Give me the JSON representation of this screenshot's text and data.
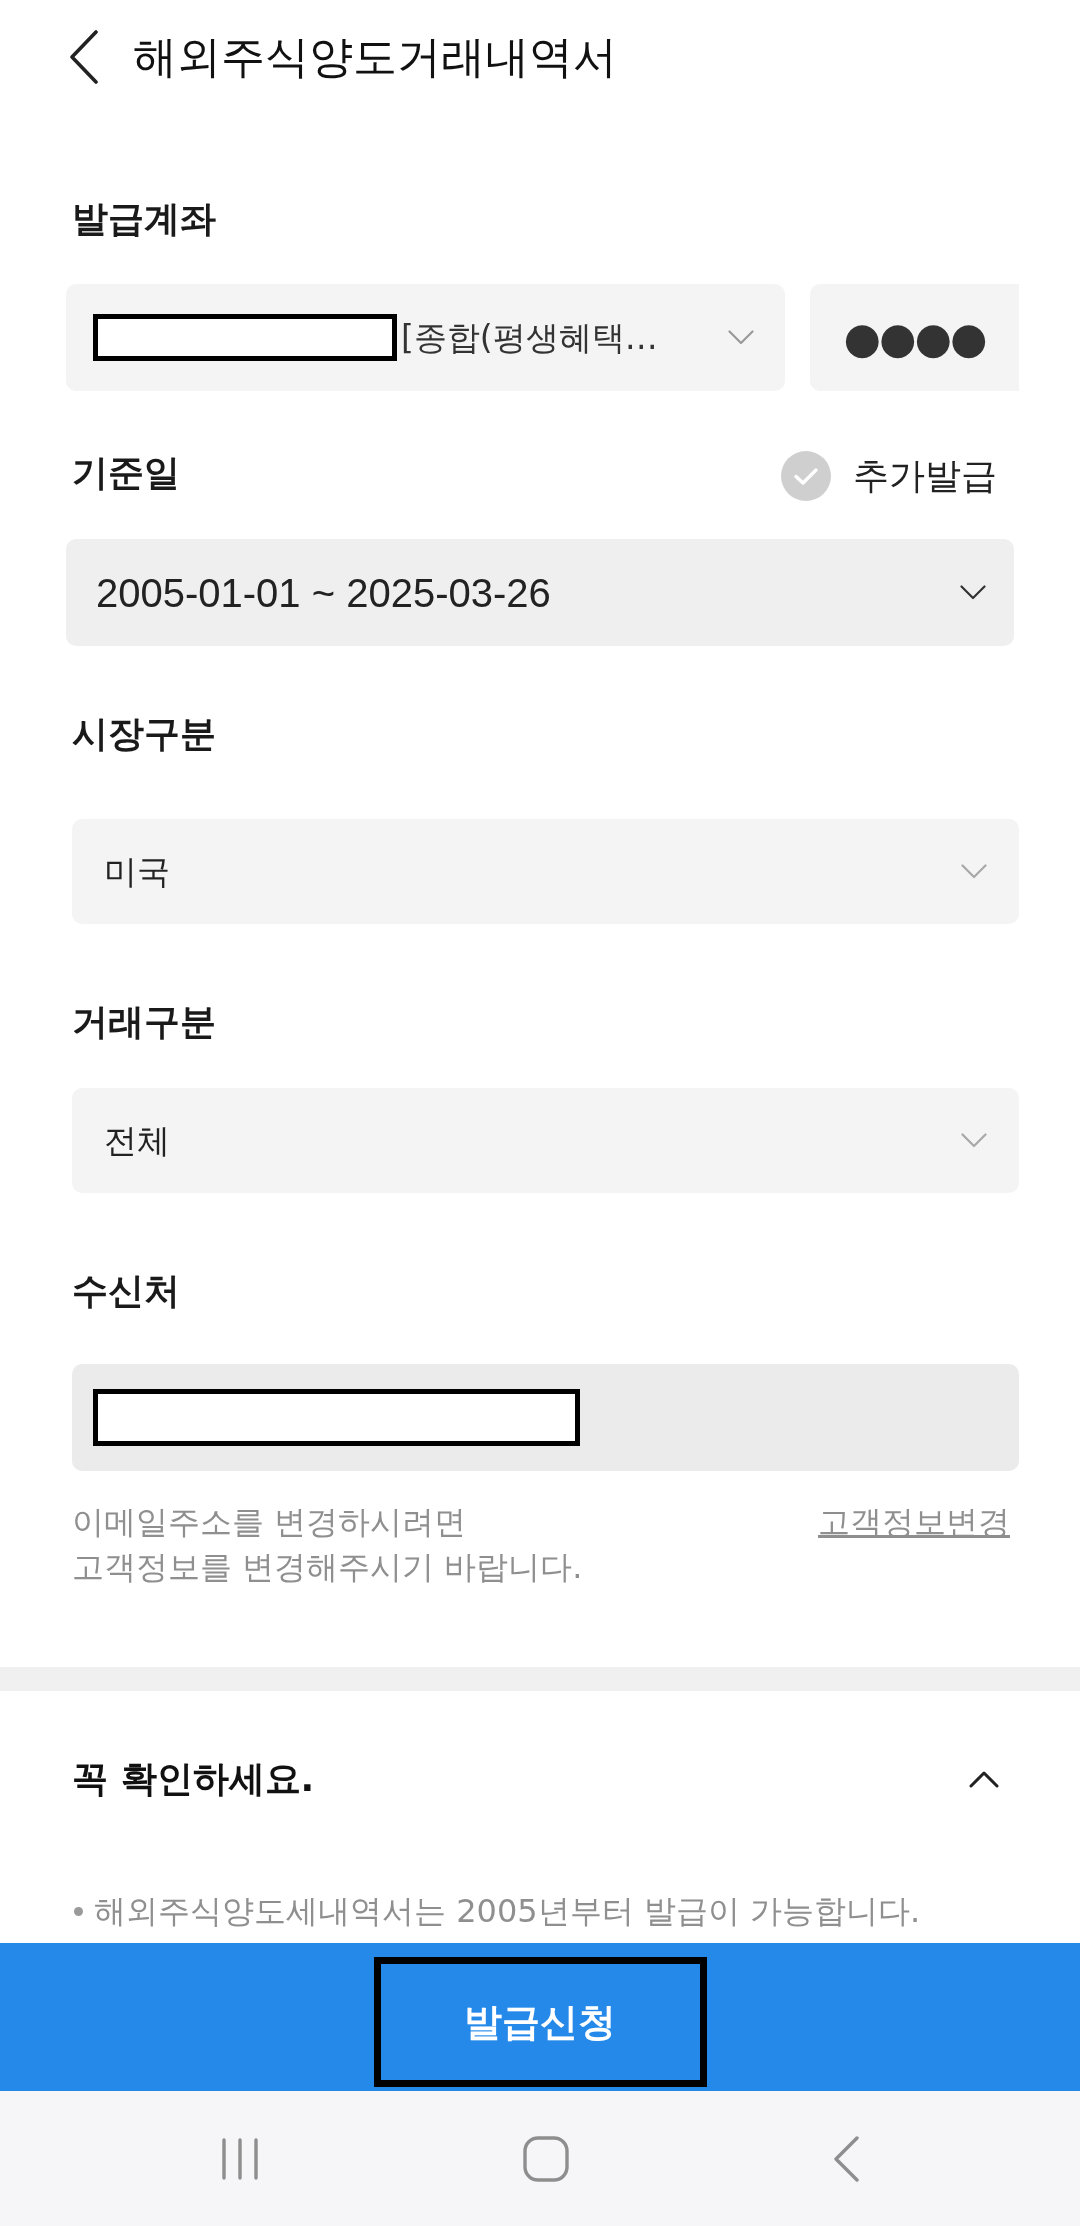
{
  "header": {
    "title": "해외주식양도거래내역서"
  },
  "account_section": {
    "label": "발급계좌",
    "account": {
      "redacted": true,
      "name": "[종합(평생혜택…"
    },
    "password": {
      "value": "●●●●"
    }
  },
  "date_section": {
    "label": "기준일",
    "additional_issue": {
      "label": "추가발급",
      "checked": false
    },
    "period": {
      "value": "2005-01-01 ~ 2025-03-26"
    }
  },
  "market_section": {
    "label": "시장구분",
    "select": {
      "value": "미국"
    }
  },
  "trade_section": {
    "label": "거래구분",
    "select": {
      "value": "전체"
    }
  },
  "recipient_section": {
    "label": "수신처",
    "email": {
      "redacted": true
    },
    "help": "이메일주소를 변경하시려면\n고객정보를 변경해주시기 바랍니다.",
    "link": "고객정보변경"
  },
  "notice": {
    "title": "꼭 확인하세요.",
    "expanded": true,
    "items": [
      "해외주식양도세내역서는 2005년부터 발급이 가능합니다."
    ]
  },
  "submit_button": {
    "label": "발급신청",
    "framed": true
  }
}
